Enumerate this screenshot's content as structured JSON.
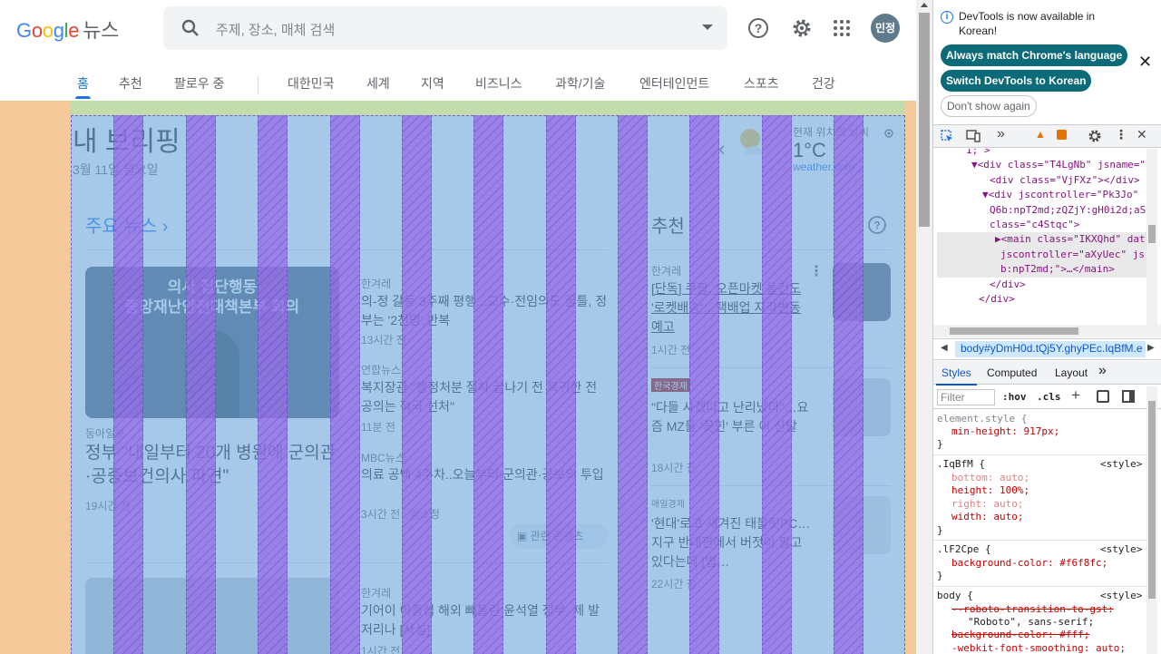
{
  "header": {
    "logo": "Google",
    "logo_suffix": "뉴스",
    "search_placeholder": "주제, 장소, 매체 검색",
    "avatar_initials": "민정"
  },
  "nav": {
    "tabs": [
      "홈",
      "추천",
      "팔로우 중",
      "대한민국",
      "세계",
      "지역",
      "비즈니스",
      "과학/기술",
      "엔터테인먼트",
      "스포츠",
      "건강"
    ]
  },
  "briefing": {
    "title": "내 브리핑",
    "date": "3월 11일 월요일",
    "weather_location": "현재 위치의 날씨",
    "temperature": "1°C",
    "weather_source": "weather.com"
  },
  "top_news": {
    "section_title": "주요 뉴스 ›",
    "image_caption_1": "의사 집단행동",
    "image_caption_2": "중앙재난안전대책본부 회의",
    "main_source": "동아일보",
    "main_headline": "정부 \"내일부터 20개 병원에 군의관·공중보건의사 파견\"",
    "main_time": "19시간 전",
    "items": [
      {
        "source": "한겨레",
        "headline": "의-정 갈등 3주째 평행...교수·전임의도 꿈틀, 정부는 '2천명' 반복",
        "time": "13시간 전"
      },
      {
        "source": "연합뉴스",
        "headline": "복지장관 \"행정처분 절차 끝나기 전 복귀한 전공의는 적극 선처\"",
        "time": "11분 전"
      },
      {
        "source": "MBC뉴스",
        "headline": "의료 공백 4주차..오늘부터 군의관·공보의 투입",
        "time": "3시간 전 · 임소정"
      },
      {
        "source": "한겨레",
        "headline": "기어이 이종섭 해외 빼돌린 윤석열 정부, 제 발 저리나 [사설]",
        "time": "1시간 전"
      }
    ],
    "coverage_button": "관련 콘텐츠"
  },
  "recommended": {
    "section_title": "추천",
    "items": [
      {
        "source": "한겨레",
        "headline": "[단독] 쿠팡, 오픈마켓 물건도 '로켓배송'…택배업 지각변동 예고",
        "time": "1시간 전"
      },
      {
        "source": "한국경제",
        "headline": "\"다들 사겠다고 난리났다\"…요즘 MZ들 '꽂힌' 부른 이 신발",
        "time": "18시간 전"
      },
      {
        "source": "매일경제",
        "headline": "'현대'로고 새겨진 태블릿PC…지구 반대편에서 버젓이 팔고 있다는데 [법…",
        "time": "22시간 전"
      }
    ]
  },
  "devtools": {
    "info_text": "DevTools is now available in Korean!",
    "btn_match": "Always match Chrome's language",
    "btn_switch": "Switch DevTools to Korean",
    "btn_dont": "Don't show again",
    "breadcrumb": "body#yDmH0d.tQj5Y.ghyPEc.IqBfM.e",
    "tabs": [
      "Styles",
      "Computed",
      "Layout"
    ],
    "filter_placeholder": "Filter",
    "hov": ":hov",
    "cls": ".cls",
    "dom_lines": [
      "1;\">",
      "▼<div class=\"T4LgNb\" jsname=\"",
      "<div class=\"VjFXz\"></div>",
      "▼<div jscontroller=\"Pk3Jo\"",
      "Q6b:npT2md;zQZjY:gH0i2d;aS",
      "class=\"c4Stqc\">",
      "▶<main class=\"IKXQhd\" dat",
      "jscontroller=\"aXyUec\" js",
      "b:npT2md;\">…</main>",
      "</div>",
      "</div>"
    ],
    "styles": [
      {
        "selector": "element.style {",
        "props": [
          "min-height: 917px;"
        ],
        "source": ""
      },
      {
        "selector": ".IqBfM {",
        "props": [
          "bottom: auto;",
          "height: 100%;",
          "right: auto;",
          "width: auto;"
        ],
        "source": "<style>"
      },
      {
        "selector": ".lF2Cpe {",
        "props": [
          "background-color: #f6f8fc;"
        ],
        "source": "<style>"
      },
      {
        "selector": "body {",
        "props": [
          "--roboto-transition-to-gst:",
          "\"Roboto\", sans-serif;",
          "background-color: #fff;",
          "-webkit-font-smoothing: auto;"
        ],
        "source": "<style>"
      }
    ]
  }
}
